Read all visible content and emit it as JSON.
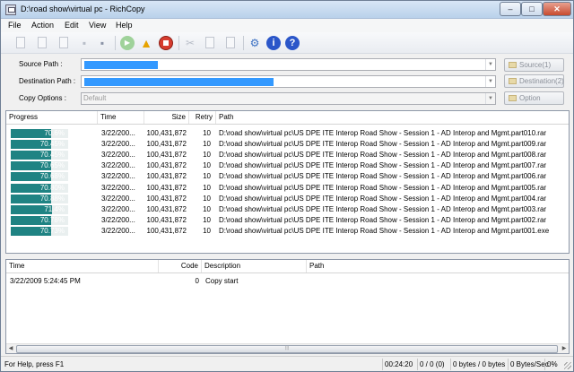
{
  "window": {
    "title": "D:\\road show\\virtual pc - RichCopy"
  },
  "menu": [
    {
      "label": "File"
    },
    {
      "label": "Action"
    },
    {
      "label": "Edit"
    },
    {
      "label": "View"
    },
    {
      "label": "Help"
    }
  ],
  "toolbar": {
    "icons": [
      "new-icon",
      "open-icon",
      "folder-icon",
      "save-icon",
      "save-as-icon",
      "start-copy-icon",
      "warning-icon",
      "stop-icon",
      "cut-icon",
      "copy-icon",
      "paste-icon",
      "config-icon",
      "info-icon",
      "help-icon"
    ]
  },
  "paths": {
    "source_label": "Source Path :",
    "destination_label": "Destination Path :",
    "copy_options_label": "Copy Options :",
    "copy_options_value": "Default",
    "source_button": "Source(1)",
    "destination_button": "Destination(2)",
    "option_button": "Option"
  },
  "progress_table": {
    "columns": [
      "Progress",
      "Time",
      "Size",
      "Retry",
      "Path"
    ],
    "rows": [
      {
        "progress": "70.6%",
        "progress_value": 0.706,
        "time": "3/22/200...",
        "size": "100,431,872",
        "retry": "10",
        "path": "D:\\road show\\virtual pc\\US DPE ITE Interop Road Show - Session 1 - AD Interop and Mgmt.part010.rar"
      },
      {
        "progress": "70.45%",
        "progress_value": 0.7045,
        "time": "3/22/200...",
        "size": "100,431,872",
        "retry": "10",
        "path": "D:\\road show\\virtual pc\\US DPE ITE Interop Road Show - Session 1 - AD Interop and Mgmt.part009.rar"
      },
      {
        "progress": "70.45%",
        "progress_value": 0.7045,
        "time": "3/22/200...",
        "size": "100,431,872",
        "retry": "10",
        "path": "D:\\road show\\virtual pc\\US DPE ITE Interop Road Show - Session 1 - AD Interop and Mgmt.part008.rar"
      },
      {
        "progress": "70.65%",
        "progress_value": 0.7065,
        "time": "3/22/200...",
        "size": "100,431,872",
        "retry": "10",
        "path": "D:\\road show\\virtual pc\\US DPE ITE Interop Road Show - Session 1 - AD Interop and Mgmt.part007.rar"
      },
      {
        "progress": "70.68%",
        "progress_value": 0.7068,
        "time": "3/22/200...",
        "size": "100,431,872",
        "retry": "10",
        "path": "D:\\road show\\virtual pc\\US DPE ITE Interop Road Show - Session 1 - AD Interop and Mgmt.part006.rar"
      },
      {
        "progress": "70.80%",
        "progress_value": 0.708,
        "time": "3/22/200...",
        "size": "100,431,872",
        "retry": "10",
        "path": "D:\\road show\\virtual pc\\US DPE ITE Interop Road Show - Session 1 - AD Interop and Mgmt.part005.rar"
      },
      {
        "progress": "70.88%",
        "progress_value": 0.7088,
        "time": "3/22/200...",
        "size": "100,431,872",
        "retry": "10",
        "path": "D:\\road show\\virtual pc\\US DPE ITE Interop Road Show - Session 1 - AD Interop and Mgmt.part004.rar"
      },
      {
        "progress": "71.4%",
        "progress_value": 0.714,
        "time": "3/22/200...",
        "size": "100,431,872",
        "retry": "10",
        "path": "D:\\road show\\virtual pc\\US DPE ITE Interop Road Show - Session 1 - AD Interop and Mgmt.part003.rar"
      },
      {
        "progress": "70.78%",
        "progress_value": 0.7078,
        "time": "3/22/200...",
        "size": "100,431,872",
        "retry": "10",
        "path": "D:\\road show\\virtual pc\\US DPE ITE Interop Road Show - Session 1 - AD Interop and Mgmt.part002.rar"
      },
      {
        "progress": "70.73%",
        "progress_value": 0.7073,
        "time": "3/22/200...",
        "size": "100,431,872",
        "retry": "10",
        "path": "D:\\road show\\virtual pc\\US DPE ITE Interop Road Show - Session 1 - AD Interop and Mgmt.part001.exe"
      }
    ]
  },
  "log_table": {
    "columns": [
      "Time",
      "Code",
      "Description",
      "Path"
    ],
    "rows": [
      {
        "time": "3/22/2009 5:24:45 PM",
        "code": "0",
        "description": "Copy start",
        "path": ""
      }
    ]
  },
  "status": {
    "help": "For Help, press F1",
    "elapsed": "00:24:20",
    "counts": "0 / 0 (0)",
    "bytes": "0 bytes / 0 bytes",
    "rate": "0 Bytes/Sec",
    "percent": "0%"
  },
  "colors": {
    "progress_fill": "#1f8383",
    "selection": "#3399ff"
  }
}
